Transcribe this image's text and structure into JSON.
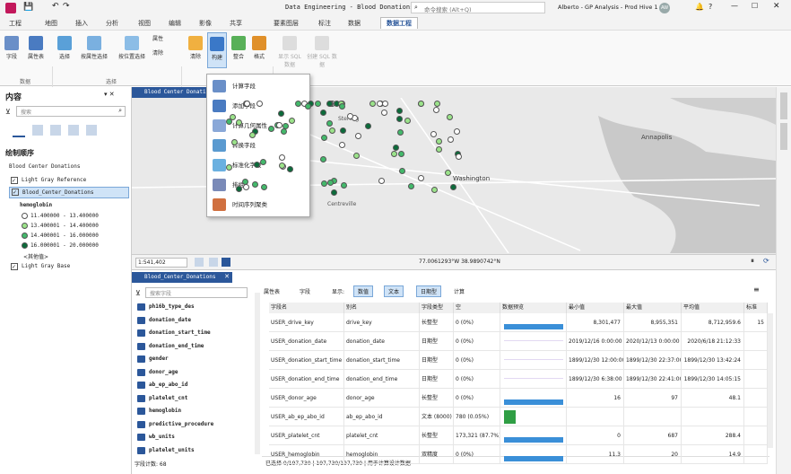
{
  "window": {
    "title": "Data Engineering - Blood Donations",
    "search_placeholder": "命令搜索 (Alt+Q)",
    "project": "Alberto - GP Analysis - Prod Hive 1",
    "avatar": "AW"
  },
  "tabs": [
    "工程",
    "地图",
    "插入",
    "分析",
    "视图",
    "编辑",
    "影像",
    "共享"
  ],
  "context_tabs": [
    "要素图层",
    "标注",
    "数据",
    "数据工程"
  ],
  "ribbon": {
    "groups": [
      "数据",
      "选择"
    ],
    "buttons": [
      "字段",
      "属性表",
      "选择",
      "按属性选择",
      "按位置选择",
      "属性",
      "清除",
      "清除",
      "构建",
      "整合",
      "格式"
    ],
    "grayed": [
      "显示 SQL 数据",
      "创建 SQL 数据"
    ]
  },
  "menu": [
    "计算字段",
    "添加字段",
    "计算几何属性",
    "转换字段",
    "标准化字段",
    "排组",
    "时间序列聚类"
  ],
  "contents": {
    "title": "内容",
    "search_placeholder": "搜索",
    "drawing_order": "绘制顺序",
    "map_name": "Blood Center Donations",
    "layers": [
      "Light Gray Reference",
      "Blood_Center_Donations"
    ],
    "legend_field": "hemoglobin",
    "legend": [
      "11.400000 - 13.400000",
      "13.400001 - 14.400000",
      "14.400001 - 16.000000",
      "16.000001 - 20.000000"
    ],
    "other": "<其他值>",
    "basemap": "Light Gray Base"
  },
  "map": {
    "tab": "Blood Center Donations",
    "scale": "1:541,402",
    "coords": "77.0061293°W 38.9890742°N",
    "places": [
      "Sterling",
      "Washington",
      "Annapolis",
      "Centreville"
    ]
  },
  "table": {
    "tab": "Blood_Center_Donations",
    "toolbar": [
      "属性表",
      "字段",
      "显示:",
      "数值",
      "文本",
      "日期型",
      "计算"
    ],
    "search": "搜索字段",
    "fields": [
      "ph16b_type_des",
      "donation_date",
      "donation_start_time",
      "donation_end_time",
      "gender",
      "donor_age",
      "ab_ep_abo_id",
      "platelet_cnt",
      "hemoglobin",
      "predictive_procedure",
      "wb_units",
      "platelet_units"
    ],
    "field_count": "字段计数: 68",
    "columns": [
      "字段名",
      "别名",
      "字段类型",
      "空",
      "数据预览",
      "最小值",
      "最大值",
      "平均值",
      "标准"
    ],
    "rows": [
      [
        "USER_drive_key",
        "drive_key",
        "长整型",
        "0 (0%)",
        "8,301,477",
        "8,955,351",
        "8,712,959.6",
        "15"
      ],
      [
        "USER_donation_date",
        "donation_date",
        "日期型",
        "0 (0%)",
        "2019/12/16 0:00:00",
        "2020/12/13 0:00:00",
        "2020/6/18 21:12:33",
        ""
      ],
      [
        "USER_donation_start_time",
        "donation_start_time",
        "日期型",
        "0 (0%)",
        "1899/12/30 12:00:00",
        "1899/12/30 22:37:00",
        "1899/12/30 13:42:24",
        ""
      ],
      [
        "USER_donation_end_time",
        "donation_end_time",
        "日期型",
        "0 (0%)",
        "1899/12/30 6:38:00",
        "1899/12/30 22:41:00",
        "1899/12/30 14:05:15",
        ""
      ],
      [
        "USER_donor_age",
        "donor_age",
        "长整型",
        "0 (0%)",
        "16",
        "97",
        "48.1",
        ""
      ],
      [
        "USER_ab_ep_abo_id",
        "ab_ep_abo_id",
        "文本 (8000)",
        "780 (0.05%)",
        "",
        "",
        "",
        ""
      ],
      [
        "USER_platelet_cnt",
        "platelet_cnt",
        "长整型",
        "173,321 (87.7%)",
        "0",
        "687",
        "288.4",
        ""
      ],
      [
        "USER_hemoglobin",
        "hemoglobin",
        "双精度",
        "0 (0%)",
        "11.3",
        "20",
        "14.9",
        ""
      ]
    ],
    "status": "已选择 0/197,730 | 197,730/197,730 | 用于计算设计数据"
  },
  "colors": {
    "accent": "#2b579a",
    "c1": "#ffffff",
    "c2": "#9be38a",
    "c3": "#43b96b",
    "c4": "#0b6b3a"
  }
}
